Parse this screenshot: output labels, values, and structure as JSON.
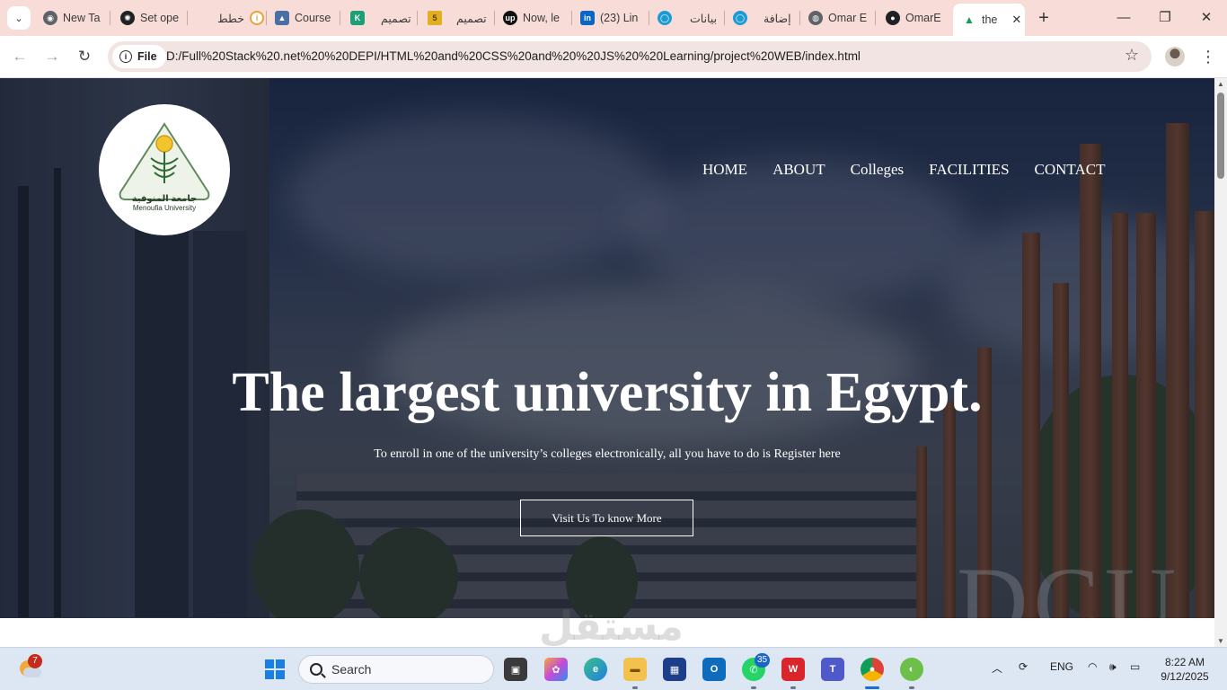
{
  "browser": {
    "tabs": [
      {
        "label": "New Ta",
        "icon": "chrome-icon",
        "color": "#5f6368"
      },
      {
        "label": "Set ope",
        "icon": "openai-icon",
        "color": "#202124"
      },
      {
        "label": "خطط",
        "icon": "info-circle-icon",
        "color": "#e8a33d"
      },
      {
        "label": "Course",
        "icon": "course-icon",
        "color": "#4a6fa5"
      },
      {
        "label": "تصميم",
        "icon": "khamsat-k-icon",
        "color": "#1d9e74"
      },
      {
        "label": "تصميم",
        "icon": "five-icon",
        "color": "#e0b020"
      },
      {
        "label": "Now, le",
        "icon": "upwork-icon",
        "color": "#111111"
      },
      {
        "label": "(23) Lin",
        "icon": "linkedin-icon",
        "color": "#0a66c2"
      },
      {
        "label": "بيانات",
        "icon": "ring-icon",
        "color": "#1c9ad6"
      },
      {
        "label": "إضافة",
        "icon": "ring-icon",
        "color": "#1c9ad6"
      },
      {
        "label": "Omar E",
        "icon": "globe-icon",
        "color": "#5f6368"
      },
      {
        "label": "OmarE",
        "icon": "github-icon",
        "color": "#202124"
      }
    ],
    "active_tab": {
      "label": "the",
      "icon": "drive-icon"
    },
    "address_chip": "File",
    "url": "D:/Full%20Stack%20.net%20%20DEPI/HTML%20and%20CSS%20and%20%20JS%20%20Learning/project%20WEB/index.html"
  },
  "page": {
    "logo": {
      "arabic": "جامعة المنوفية",
      "english": "Menoufia University"
    },
    "nav": [
      "HOME",
      "ABOUT",
      "Colleges",
      "FACILITIES",
      "CONTACT"
    ],
    "headline": "The largest university in Egypt.",
    "subline": "To enroll in one of the university’s colleges electronically, all you have to do is Register here",
    "cta": "Visit Us To know More",
    "background_sign": "DCU",
    "watermark": "مستقل"
  },
  "taskbar": {
    "search_placeholder": "Search",
    "weather_badge": "7",
    "whatsapp_badge": "35",
    "language": "ENG",
    "time": "8:22 AM",
    "date": "9/12/2025"
  }
}
